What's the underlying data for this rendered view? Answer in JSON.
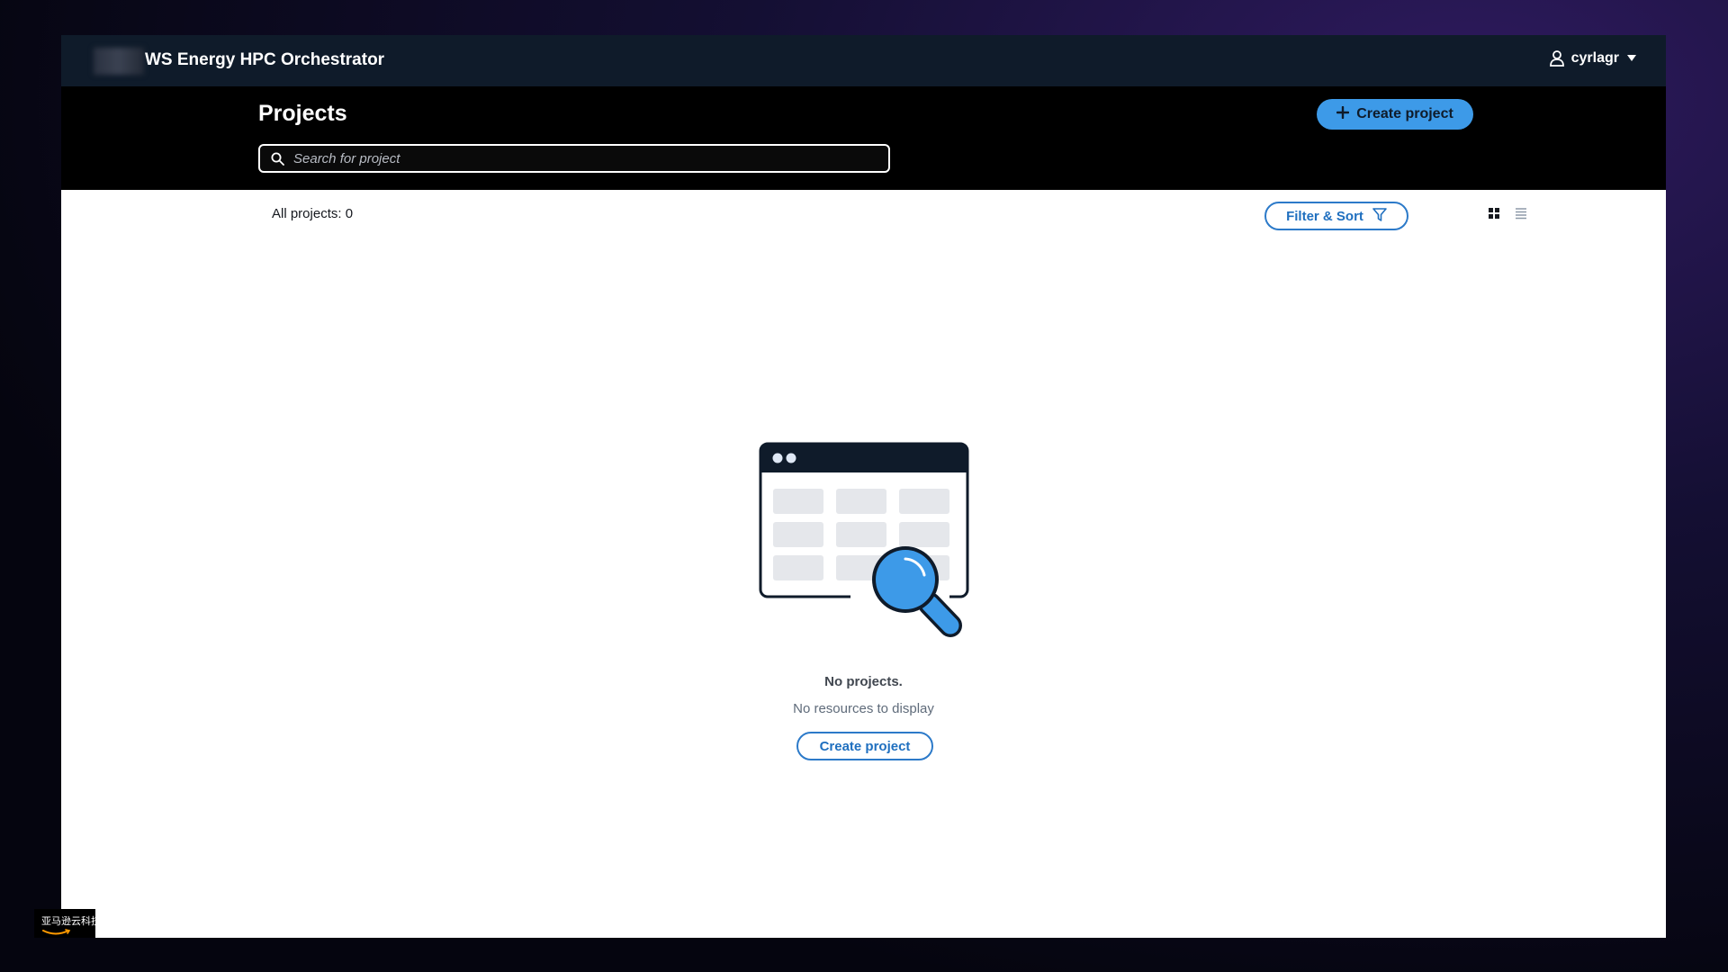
{
  "app": {
    "title": "WS Energy HPC Orchestrator"
  },
  "user": {
    "name": "cyrlagr"
  },
  "header": {
    "page_title": "Projects",
    "create_button_label": "Create project"
  },
  "search": {
    "placeholder": "Search for project",
    "value": ""
  },
  "toolbar": {
    "count_label": "All projects: 0",
    "filter_sort_label": "Filter & Sort"
  },
  "empty_state": {
    "title": "No projects.",
    "description": "No resources to display",
    "button_label": "Create project"
  },
  "watermark": {
    "text": "亚马逊云科技"
  },
  "colors": {
    "nav_bg": "#0f1b2a",
    "header_bg": "#000000",
    "primary": "#3d9ae8",
    "link_blue": "#1f6fbf"
  },
  "icons": {
    "user": "user-icon",
    "dropdown": "caret-down-icon",
    "plus": "plus-icon",
    "search": "search-icon",
    "filter": "filter-icon",
    "grid_view": "grid-view-icon",
    "list_view": "list-view-icon",
    "empty": "empty-search-illustration"
  }
}
